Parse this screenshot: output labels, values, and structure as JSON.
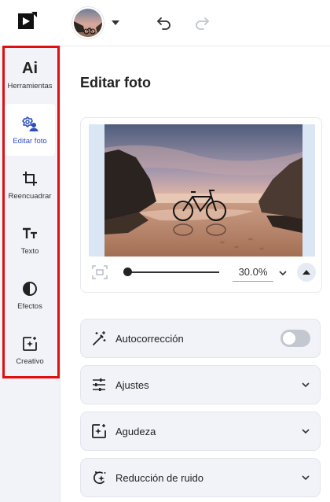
{
  "sidebar": {
    "items": [
      {
        "label": "Herramientas",
        "icon": "ai-tools-icon"
      },
      {
        "label": "Editar foto",
        "icon": "edit-photo-icon"
      },
      {
        "label": "Reencuadrar",
        "icon": "crop-icon"
      },
      {
        "label": "Texto",
        "icon": "text-icon"
      },
      {
        "label": "Efectos",
        "icon": "effects-icon"
      },
      {
        "label": "Creativo",
        "icon": "creative-icon"
      }
    ],
    "ai_glyph": "Ai",
    "active_index": 1
  },
  "main": {
    "title": "Editar foto",
    "zoom": {
      "value": "30.0%",
      "slider_level": 0.0
    },
    "sections": [
      {
        "label": "Autocorrección",
        "icon": "magic-wand-icon",
        "control": "toggle",
        "toggle_on": false
      },
      {
        "label": "Ajustes",
        "icon": "sliders-icon",
        "control": "chevron"
      },
      {
        "label": "Agudeza",
        "icon": "sharpen-icon",
        "control": "chevron"
      },
      {
        "label": "Reducción de ruido",
        "icon": "denoise-icon",
        "control": "chevron"
      }
    ]
  },
  "colors": {
    "accent": "#2f4fbf",
    "highlight_frame": "#e01010",
    "sidebar_bg": "#f1f3f8"
  }
}
